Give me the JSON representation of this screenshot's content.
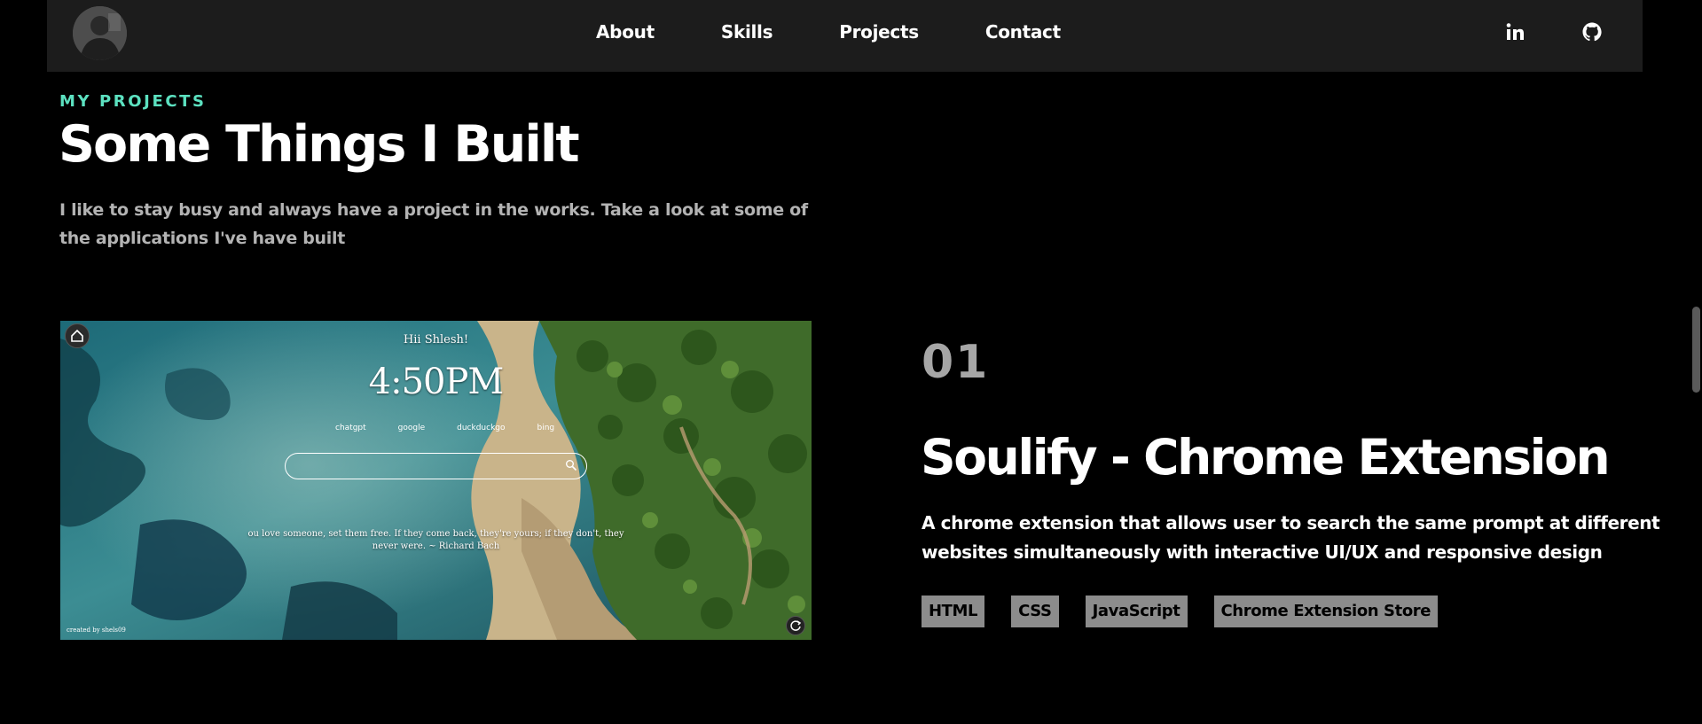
{
  "nav": {
    "links": [
      "About",
      "Skills",
      "Projects",
      "Contact"
    ],
    "social": [
      "linkedin-icon",
      "github-icon"
    ]
  },
  "section": {
    "eyebrow": "MY PROJECTS",
    "title": "Some Things I Built",
    "intro_lines": [
      "I like to stay busy and always have a project in the works. Take a look at some of",
      "the applications I've have built"
    ]
  },
  "project": {
    "number": "01",
    "title": "Soulify - Chrome Extension",
    "description_lines": [
      "A chrome extension that allows user to search the same prompt at different",
      "websites simultaneously with interactive UI/UX and responsive design"
    ],
    "tags": [
      "HTML",
      "CSS",
      "JavaScript",
      "Chrome Extension Store"
    ],
    "screenshot": {
      "greeting": "Hii Shlesh!",
      "time": "4:50PM",
      "engines": [
        "chatgpt",
        "google",
        "duckduckgo",
        "bing"
      ],
      "quote": "ou love someone, set them free. If they come back, they're yours; if they don't, they never were. ~ Richard Bach",
      "credit": "created by shels09"
    }
  },
  "colors": {
    "accent": "#5ce1c0",
    "navbar": "#1c1c1c",
    "tag_bg": "#8c8c8c",
    "muted_text": "#b3b3b3"
  }
}
